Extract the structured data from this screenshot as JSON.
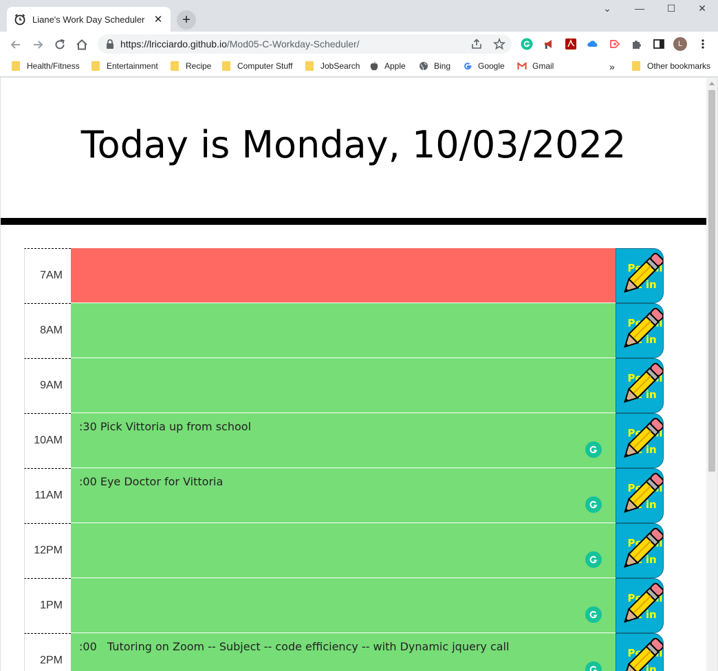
{
  "browser": {
    "tab_title": "Liane's Work Day Scheduler",
    "tab_close": "✕",
    "new_tab": "+",
    "url_host": "https://lricciardo.github.io",
    "url_path": "/Mod05-C-Workday-Scheduler/",
    "avatar_letter": "L",
    "bookmarks": [
      {
        "label": "Health/Fitness",
        "icon": "folder-icon"
      },
      {
        "label": "Entertainment",
        "icon": "folder-icon"
      },
      {
        "label": "Recipe",
        "icon": "folder-icon"
      },
      {
        "label": "Computer Stuff",
        "icon": "folder-icon"
      },
      {
        "label": "JobSearch",
        "icon": "folder-icon"
      },
      {
        "label": "Apple",
        "icon": "apple-icon"
      },
      {
        "label": "Bing",
        "icon": "globe-icon"
      },
      {
        "label": "Google",
        "icon": "google-icon"
      },
      {
        "label": "Gmail",
        "icon": "gmail-icon"
      }
    ],
    "bookmarks_overflow": "»",
    "other_bookmarks": "Other bookmarks"
  },
  "page": {
    "heading": "Today is Monday, 10/03/2022",
    "save_label": "Pencil it in",
    "colors": {
      "past": "#ff6961",
      "future": "#77dd77",
      "save": "#06aed5"
    },
    "blocks": [
      {
        "hour": "7AM",
        "status": "past",
        "text": ""
      },
      {
        "hour": "8AM",
        "status": "future",
        "text": ""
      },
      {
        "hour": "9AM",
        "status": "future",
        "text": ""
      },
      {
        "hour": "10AM",
        "status": "future",
        "text": ":30 Pick Vittoria up from school"
      },
      {
        "hour": "11AM",
        "status": "future",
        "text": ":00 Eye Doctor for Vittoria"
      },
      {
        "hour": "12PM",
        "status": "future",
        "text": ""
      },
      {
        "hour": "1PM",
        "status": "future",
        "text": ""
      },
      {
        "hour": "2PM",
        "status": "future",
        "text": ":00   Tutoring on Zoom -- Subject -- code efficiency -- with Dynamic jquery call"
      }
    ]
  }
}
